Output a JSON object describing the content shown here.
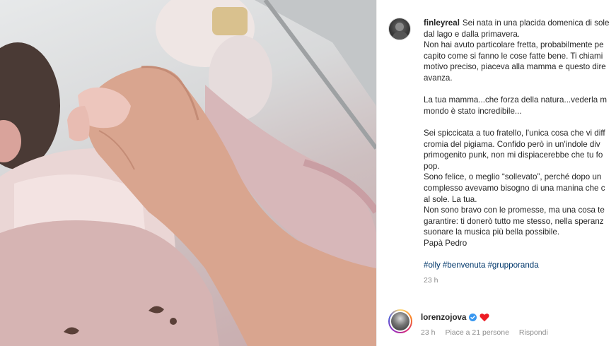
{
  "post": {
    "username": "finleyreal",
    "caption_lines": [
      "Sei nata in una placida domenica di sole",
      "dal lago e dalla primavera.",
      "Non hai avuto particolare fretta, probabilmente pe",
      "capito come si fanno le cose fatte bene. Ti chiami",
      "motivo preciso, piaceva alla mamma e questo dire",
      "avanza.",
      "",
      "La tua mamma...che forza della natura...vederla m",
      "mondo è stato incredibile...",
      "",
      "Sei spiccicata a tuo fratello, l'unica cosa che vi diff",
      "cromia del pigiama. Confido però in un'indole div",
      "primogenito punk, non mi dispiacerebbe che tu fo",
      "pop.",
      "Sono felice, o meglio “sollevato”, perché dopo un",
      "complesso avevamo bisogno di una manina che c",
      "al sole. La tua.",
      "Non sono bravo con le promesse, ma una cosa te",
      "garantire: ti donerò tutto me stesso, nella speranz",
      "suonare la musica più bella possibile.",
      "Papà Pedro",
      "",
      "#olly #benvenuta #grupporanda"
    ],
    "hashtags": [
      "#olly",
      "#benvenuta",
      "#grupporanda"
    ],
    "time": "23 h"
  },
  "comment": {
    "username": "lorenzojova",
    "verified_icon": "verified-badge-icon",
    "heart_icon": "red-heart-emoji",
    "time": "23 h",
    "likes": "Piace a 21 persone",
    "reply": "Rispondi"
  },
  "colors": {
    "link": "#00376b",
    "verified": "#3897f0",
    "heart": "#ed1c24",
    "meta": "#8e8e8e"
  }
}
